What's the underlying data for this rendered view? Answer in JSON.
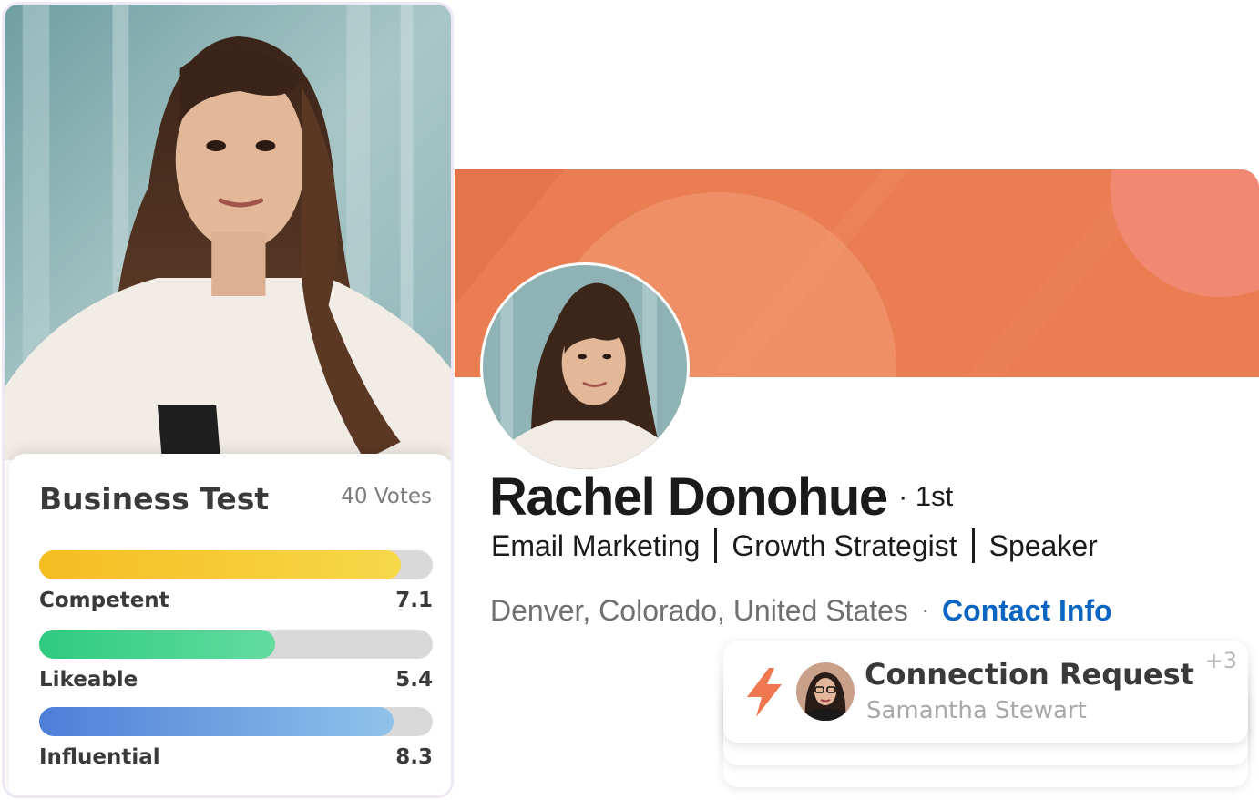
{
  "score_card": {
    "title": "Business Test",
    "votes": "40 Votes",
    "metrics": [
      {
        "label": "Competent",
        "value": "7.1",
        "fill": 0.92
      },
      {
        "label": "Likeable",
        "value": "5.4",
        "fill": 0.6
      },
      {
        "label": "Influential",
        "value": "8.3",
        "fill": 0.9
      }
    ]
  },
  "profile": {
    "name": "Rachel Donohue",
    "degree": "· 1st",
    "headline": [
      "Email Marketing",
      "Growth Strategist",
      "Speaker"
    ],
    "location": "Denver, Colorado, United States",
    "location_separator": "·",
    "contact_link": "Contact Info"
  },
  "notification": {
    "title": "Connection Request",
    "subtitle": "Samantha Stewart",
    "count": "+3",
    "icon": "lightning-bolt-icon"
  },
  "colors": {
    "banner": "#ea7d52",
    "link": "#0a66c2",
    "bolt": "#f07850"
  }
}
